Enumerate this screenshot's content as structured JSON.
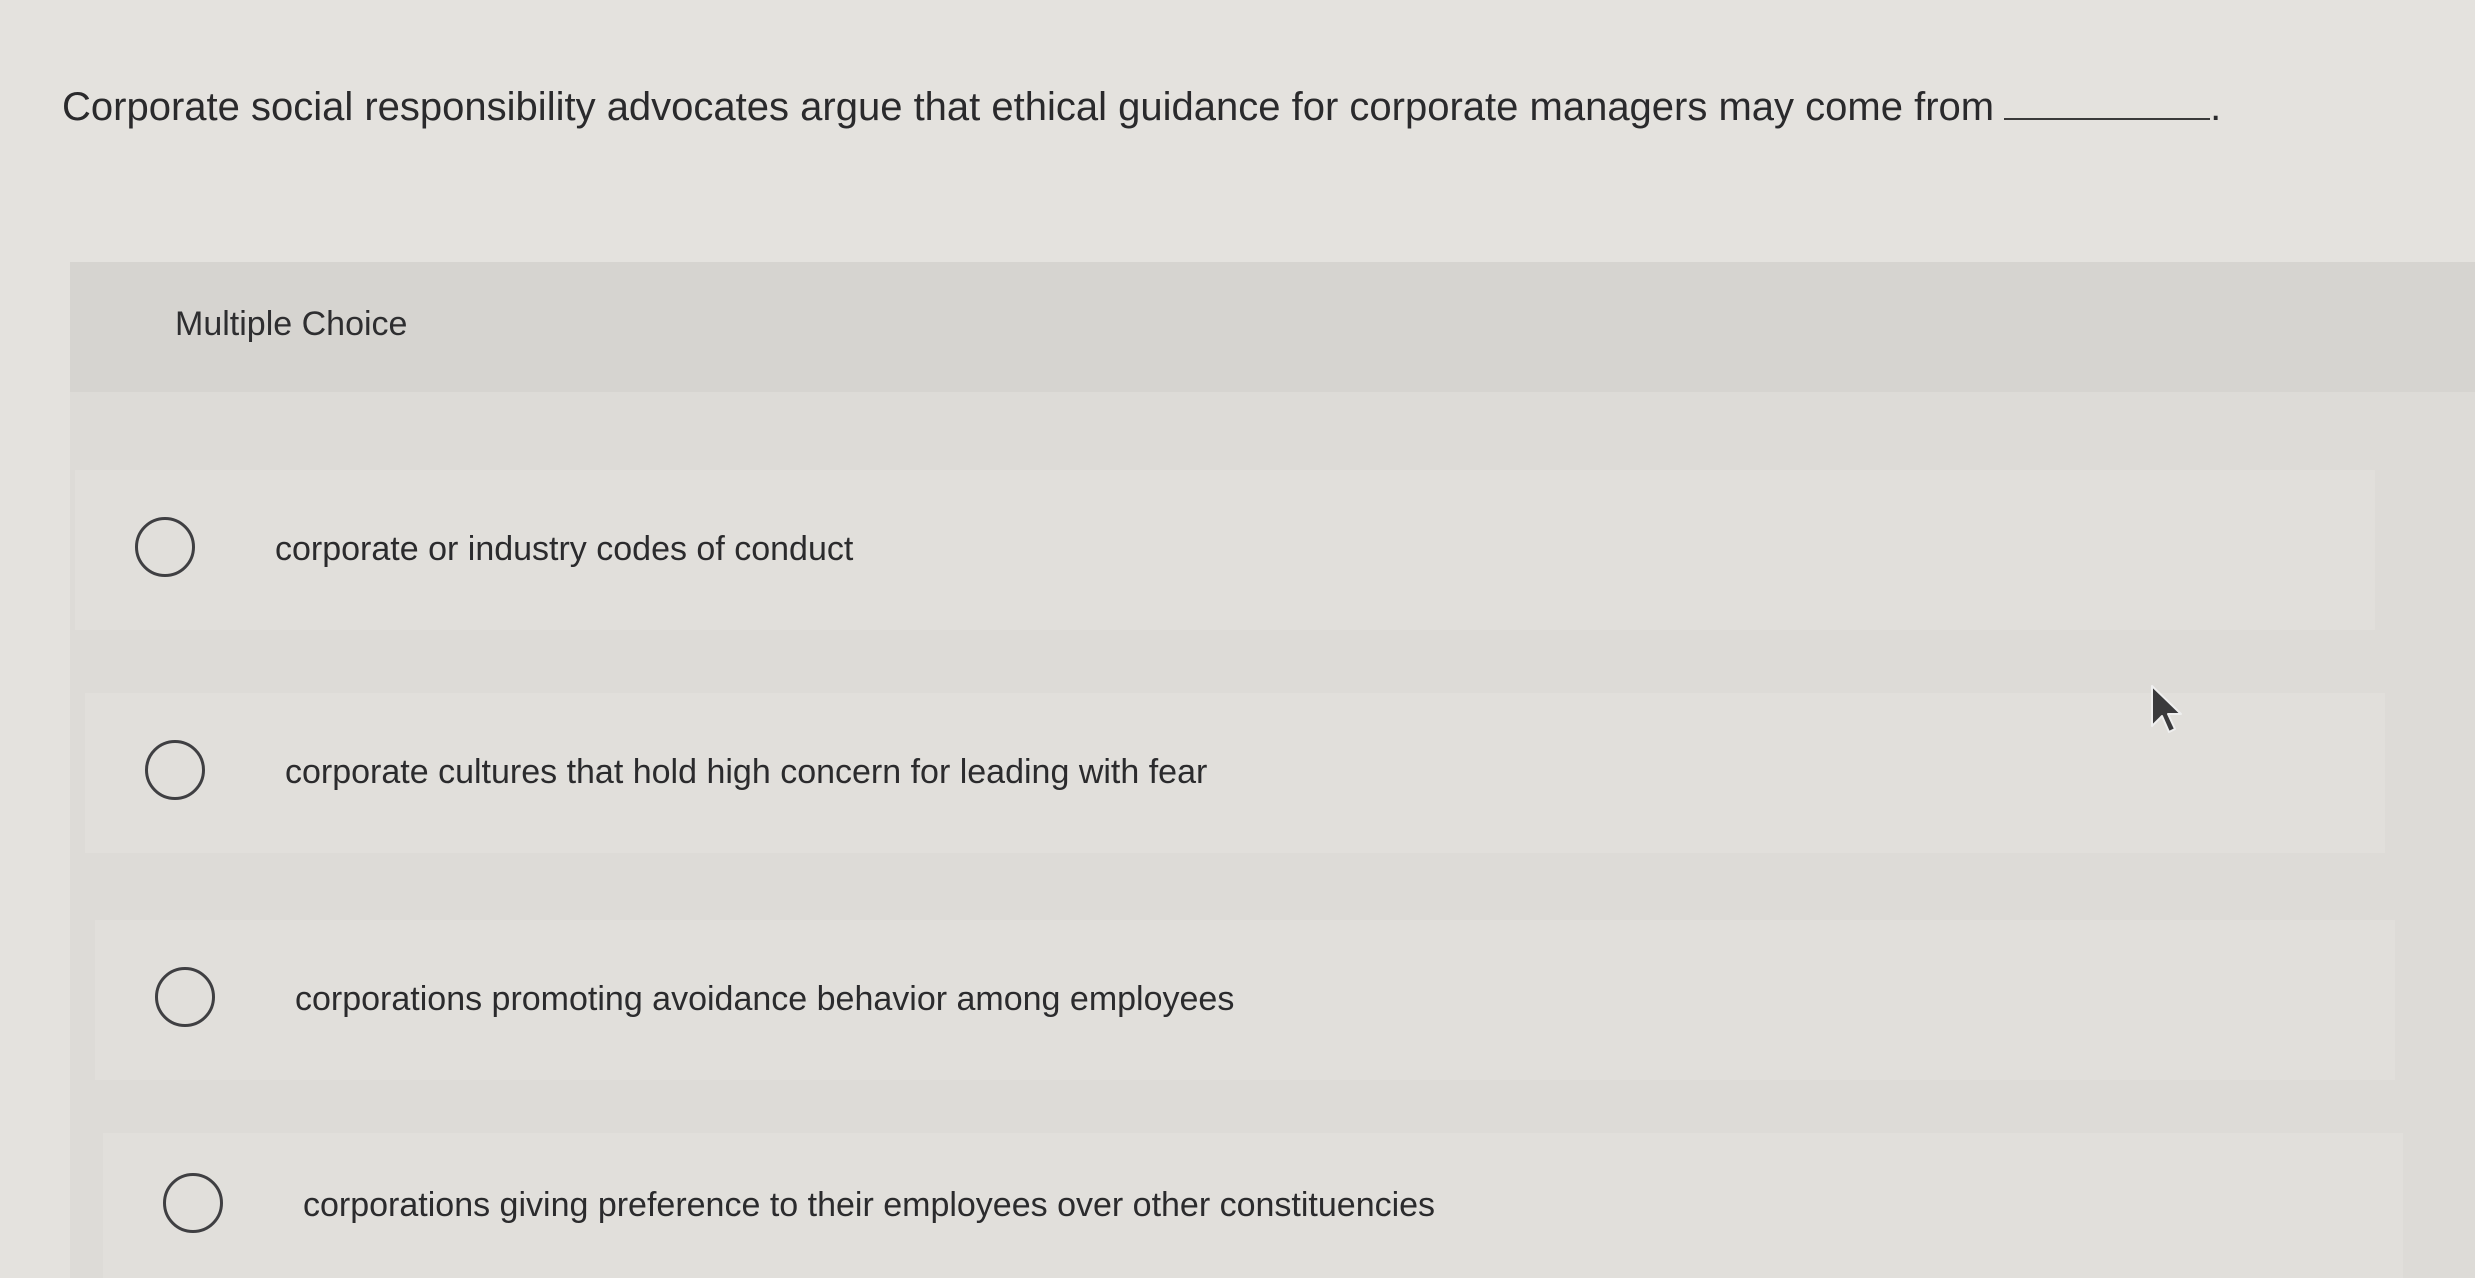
{
  "question": {
    "text": "Corporate social responsibility advocates argue that ethical guidance for corporate managers may come from",
    "blank_suffix": "."
  },
  "panel": {
    "title": "Multiple Choice"
  },
  "options": [
    {
      "label": "corporate or industry codes of conduct",
      "selected": false
    },
    {
      "label": "corporate cultures that hold high concern for leading with fear",
      "selected": false
    },
    {
      "label": "corporations promoting avoidance behavior among employees",
      "selected": false
    },
    {
      "label": "corporations giving preference to their employees over other constituencies",
      "selected": false
    }
  ],
  "icons": {
    "cursor": "mouse-pointer-icon"
  }
}
